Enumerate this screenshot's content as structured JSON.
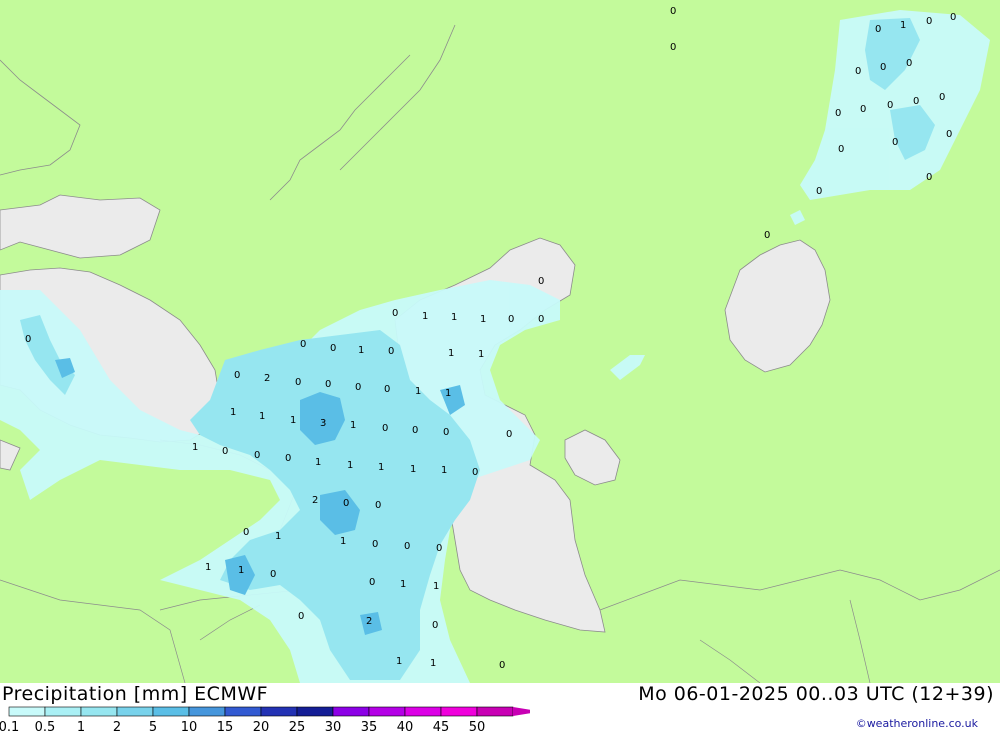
{
  "title": {
    "left": "Precipitation [mm] ECMWF",
    "right": "Mo 06-01-2025 00..03 UTC (12+39)",
    "credit": "©weatheronline.co.uk"
  },
  "legend": {
    "labels": [
      "0.1",
      "0.5",
      "1",
      "2",
      "5",
      "10",
      "15",
      "20",
      "25",
      "30",
      "35",
      "40",
      "45",
      "50"
    ],
    "colors": [
      "#c8fafa",
      "#aaf0f5",
      "#96e6f0",
      "#78d2eb",
      "#5abee6",
      "#4696dc",
      "#325ad2",
      "#2332b4",
      "#141e96",
      "#8c00e6",
      "#b400e6",
      "#dc00e6",
      "#f000dc",
      "#c800b4"
    ]
  },
  "colors": {
    "land": "#c3fa9b",
    "water": "#ebebeb",
    "precip_light": "#c8fafa",
    "precip_mid": "#96e6f0",
    "precip_high": "#5abee6"
  },
  "map_values": [
    "0",
    "1",
    "0",
    "0",
    "0",
    "0",
    "0",
    "0",
    "0",
    "0",
    "0",
    "0",
    "0",
    "0",
    "0",
    "0",
    "0",
    "0",
    "0",
    "0",
    "0",
    "0",
    "0",
    "1",
    "1",
    "1",
    "0",
    "0",
    "0",
    "1",
    "1",
    "0",
    "1",
    "0",
    "0",
    "0",
    "2",
    "0",
    "0",
    "0",
    "1",
    "1",
    "1",
    "1",
    "1",
    "3",
    "1",
    "0",
    "0",
    "0",
    "0",
    "1",
    "0",
    "0",
    "0",
    "1",
    "1",
    "1",
    "1",
    "1",
    "0",
    "2",
    "0",
    "0",
    "0",
    "1",
    "1",
    "0",
    "0",
    "0",
    "1",
    "1",
    "0",
    "1",
    "1",
    "0",
    "2",
    "0",
    "0",
    "1",
    "1",
    "0"
  ]
}
